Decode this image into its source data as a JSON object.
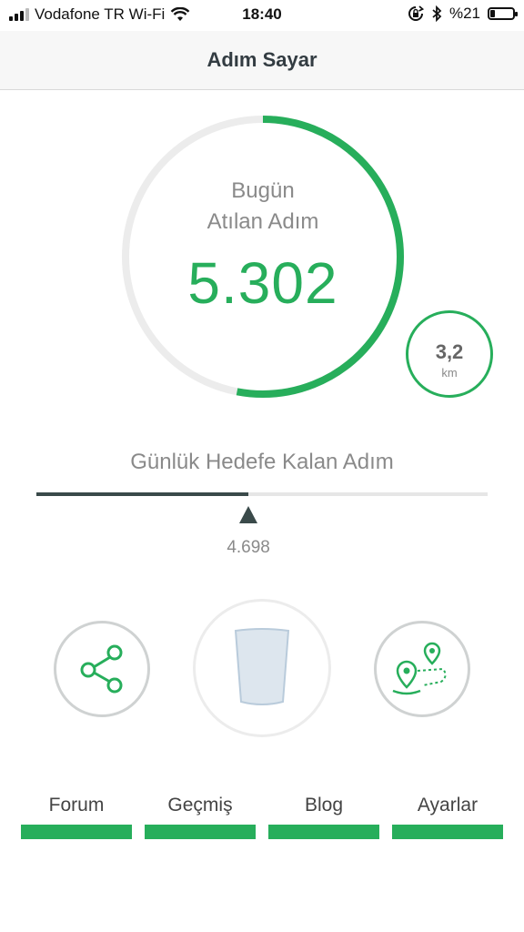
{
  "status_bar": {
    "carrier": "Vodafone TR Wi-Fi",
    "time": "18:40",
    "battery_text": "%21",
    "battery_level": 0.21,
    "icons": [
      "signal-icon",
      "wifi-icon",
      "orientation-lock-icon",
      "bluetooth-icon",
      "battery-icon"
    ]
  },
  "nav": {
    "title": "Adım Sayar"
  },
  "today": {
    "label_line1": "Bugün",
    "label_line2": "Atılan Adım",
    "steps": "5.302",
    "ring_progress": 0.53
  },
  "distance": {
    "value": "3,2",
    "unit": "km"
  },
  "goal": {
    "label": "Günlük Hedefe Kalan Adım",
    "remaining": "4.698",
    "progress": 0.47
  },
  "actions": {
    "share_icon": "share-icon",
    "cup_icon": "water-cup-icon",
    "map_icon": "route-map-icon"
  },
  "tabs": [
    {
      "label": "Forum"
    },
    {
      "label": "Geçmiş"
    },
    {
      "label": "Blog"
    },
    {
      "label": "Ayarlar"
    }
  ],
  "colors": {
    "accent": "#27ae5b",
    "ring_track": "#ececec",
    "goal_fill": "#3a4a4a"
  }
}
